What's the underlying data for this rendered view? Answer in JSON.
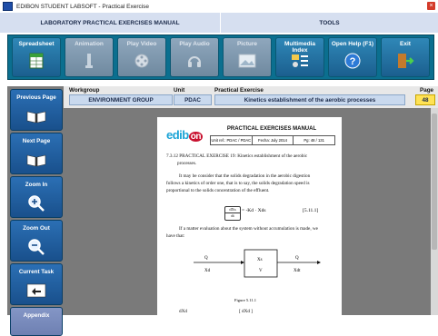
{
  "window": {
    "title": "EDIBON STUDENT LABSOFT - Practical Exercise"
  },
  "header": {
    "left": "LABORATORY PRACTICAL EXERCISES MANUAL",
    "right": "TOOLS"
  },
  "toolbar": {
    "spreadsheet": "Spreadsheet",
    "animation": "Animation",
    "play_video": "Play Video",
    "play_audio": "Play Audio",
    "picture": "Picture",
    "multimedia_index": "Multimedia Index",
    "open_help": "Open Help (F1)",
    "exit": "Exit"
  },
  "nav": {
    "previous_page": "Previous Page",
    "next_page": "Next Page",
    "zoom_in": "Zoom In",
    "zoom_out": "Zoom Out",
    "current_task": "Current Task",
    "appendix": "Appendix"
  },
  "info": {
    "workgroup_label": "Workgroup",
    "workgroup_value": "ENVIRONMENT GROUP",
    "unit_label": "Unit",
    "unit_value": "PDAC",
    "exercise_label": "Practical Exercise",
    "exercise_value": "Kinetics establishment of the aerobic processes",
    "page_label": "Page",
    "page_value": "48"
  },
  "document": {
    "logo_a": "edib",
    "logo_b": "on",
    "manual_title": "PRACTICAL EXERCISES MANUAL",
    "cell_unit": "Unit ref.: PDAC / PDAC",
    "cell_date": "Fecha: July 2014",
    "cell_page": "Pg: 48 / 131",
    "heading": "7.3.12 PRACTICAL EXERCISE 19: Kinetics establishment of the aerobic",
    "heading2": "processes.",
    "para1": "It may be consider that the solids degradation in the aerobic digestion",
    "para2": "follows a kinetics of order one, that is to say, the solids degradation speed is",
    "para3": "proportional to the solids concentration of the effluent.",
    "eq_frac_top": "dXs",
    "eq_frac_bot": "dt",
    "eq_rhs": "= -Kd · Xds",
    "eq_number": "[5.11.1]",
    "para4": "If a matter evaluation about the system without accumulation is made, we",
    "para5": "have that:",
    "diag_q_in": "Q",
    "diag_x_in": "Xd",
    "diag_box_top": "Xs",
    "diag_box_bot": "V",
    "diag_q_out": "Q",
    "diag_x_out": "Xdt",
    "figure_caption": "Figure 5.11.1",
    "bottom_left": "dXd",
    "bottom_mid": "[ dXd ]"
  },
  "colors": {
    "toolbar_bg": "#0b6f8f",
    "button_blue": "#2b6fb4",
    "page_badge": "#ffe255",
    "value_box": "#c9d9ee"
  }
}
